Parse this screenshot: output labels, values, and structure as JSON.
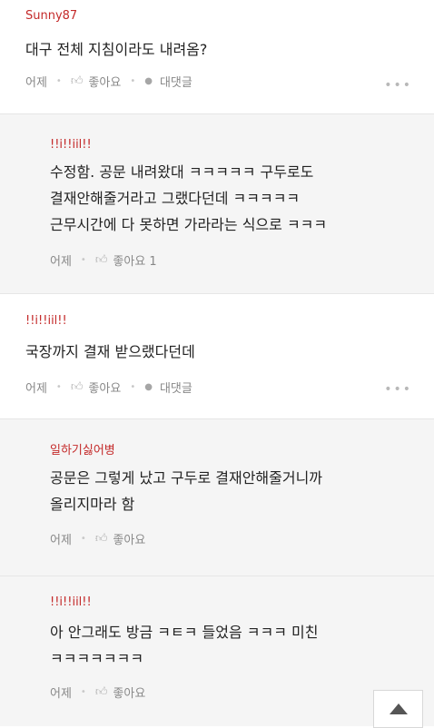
{
  "comments": [
    {
      "author": "Sunny87",
      "lines": [
        "대구 전체 지침이라도 내려옴?"
      ],
      "time": "어제",
      "like_label": "좋아요",
      "reply_label": "대댓글"
    },
    {
      "author": "!!i!!iil!!",
      "lines": [
        "수정함. 공문 내려왔대 ㅋㅋㅋㅋㅋ 구두로도",
        "결재안해줄거라고 그랬다던데 ㅋㅋㅋㅋㅋ",
        "근무시간에 다 못하면 가라라는 식으로 ㅋㅋㅋ"
      ],
      "time": "어제",
      "like_label": "좋아요 1"
    },
    {
      "author": "!!i!!iil!!",
      "lines": [
        "국장까지 결재 받으랬다던데"
      ],
      "time": "어제",
      "like_label": "좋아요",
      "reply_label": "대댓글"
    },
    {
      "author": "일하기싫어병",
      "lines": [
        "공문은 그렇게 났고 구두로 결재안해줄거니까",
        "올리지마라 함"
      ],
      "time": "어제",
      "like_label": "좋아요"
    },
    {
      "author": "!!i!!iil!!",
      "lines": [
        "아 안그래도 방금 ㅋㅌㅋ 들었음 ㅋㅋㅋ 미친",
        "ㅋㅋㅋㅋㅋㅋㅋ"
      ],
      "time": "어제",
      "like_label": "좋아요"
    }
  ],
  "more_label": "•••",
  "icons": {
    "like": "thumbs-up-icon",
    "reply": "speech-bubble-icon",
    "more": "more-dots-icon",
    "scroll_top": "arrow-up-icon"
  },
  "colors": {
    "author": "#c42a2a",
    "reply_background": "#f5f5f5",
    "meta_text": "#888888"
  }
}
